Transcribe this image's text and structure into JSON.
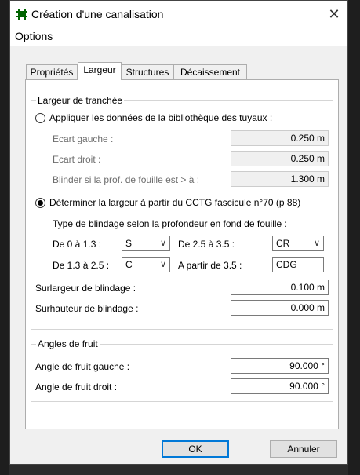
{
  "window": {
    "title": "Création d'une canalisation",
    "close_glyph": "✕"
  },
  "menu": {
    "options": "Options"
  },
  "tabs": [
    "Propriétés",
    "Largeur",
    "Structures",
    "Décaissement"
  ],
  "largeur": {
    "group_label": "Largeur de tranchée",
    "radio_biblio": {
      "label": "Appliquer les données de la bibliothèque des tuyaux :",
      "selected": false
    },
    "ecart_gauche": {
      "label": "Ecart gauche :",
      "value": "0.250 m"
    },
    "ecart_droit": {
      "label": "Ecart droit :",
      "value": "0.250 m"
    },
    "blinder": {
      "label": "Blinder si la prof. de fouille est > à :",
      "value": "1.300 m"
    },
    "radio_cctg": {
      "label": "Déterminer la largeur à partir du CCTG fascicule n°70 (p 88)",
      "selected": true
    },
    "type_blindage_label": "Type de blindage selon la profondeur en fond de fouille :",
    "de0": {
      "label": "De 0 à 1.3 :",
      "value": "S"
    },
    "de25": {
      "label": "De 2.5 à 3.5 :",
      "value": "CR"
    },
    "de13": {
      "label": "De 1.3 à 2.5 :",
      "value": "C"
    },
    "apartir": {
      "label": "A partir de 3.5 :",
      "value": "CDG"
    },
    "surlargeur": {
      "label": "Surlargeur de blindage :",
      "value": "0.100 m"
    },
    "surhauteur": {
      "label": "Surhauteur de blindage :",
      "value": "0.000 m"
    }
  },
  "angles": {
    "group_label": "Angles de fruit",
    "gauche": {
      "label": "Angle de fruit gauche :",
      "value": "90.000 °"
    },
    "droit": {
      "label": "Angle de fruit droit :",
      "value": "90.000 °"
    }
  },
  "buttons": {
    "ok": "OK",
    "cancel": "Annuler"
  },
  "icons": {
    "chevron": "∨"
  }
}
